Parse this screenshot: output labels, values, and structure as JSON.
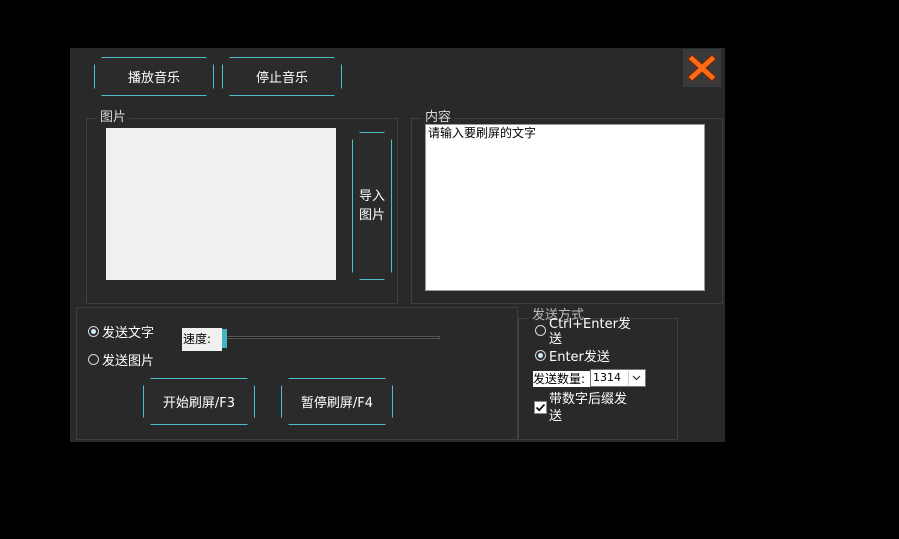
{
  "music": {
    "play_label": "播放音乐",
    "stop_label": "停止音乐"
  },
  "image_group": {
    "label": "图片",
    "import_line1": "导入",
    "import_line2": "图片"
  },
  "content_group": {
    "label": "内容",
    "text": "请输入要刷屏的文字"
  },
  "send_type": {
    "text_label": "发送文字",
    "image_label": "发送图片",
    "selected": "text"
  },
  "speed": {
    "label": "速度:",
    "value": 0
  },
  "actions": {
    "start_label": "开始刷屏/F3",
    "pause_label": "暂停刷屏/F4"
  },
  "send_mode": {
    "label": "发送方式",
    "ctrl_enter_label": "Ctrl+Enter发送",
    "enter_label": "Enter发送",
    "selected": "enter",
    "count_label": "发送数量:",
    "count_value": "1314",
    "suffix_label": "带数字后缀发送",
    "suffix_checked": true
  },
  "colors": {
    "accent": "#4bbfc7",
    "window_bg": "#292929",
    "close_icon": "#ff6a1a"
  },
  "icons": {
    "close": "close-x-icon",
    "dropdown": "chevron-down-icon",
    "check": "checkmark-icon"
  }
}
